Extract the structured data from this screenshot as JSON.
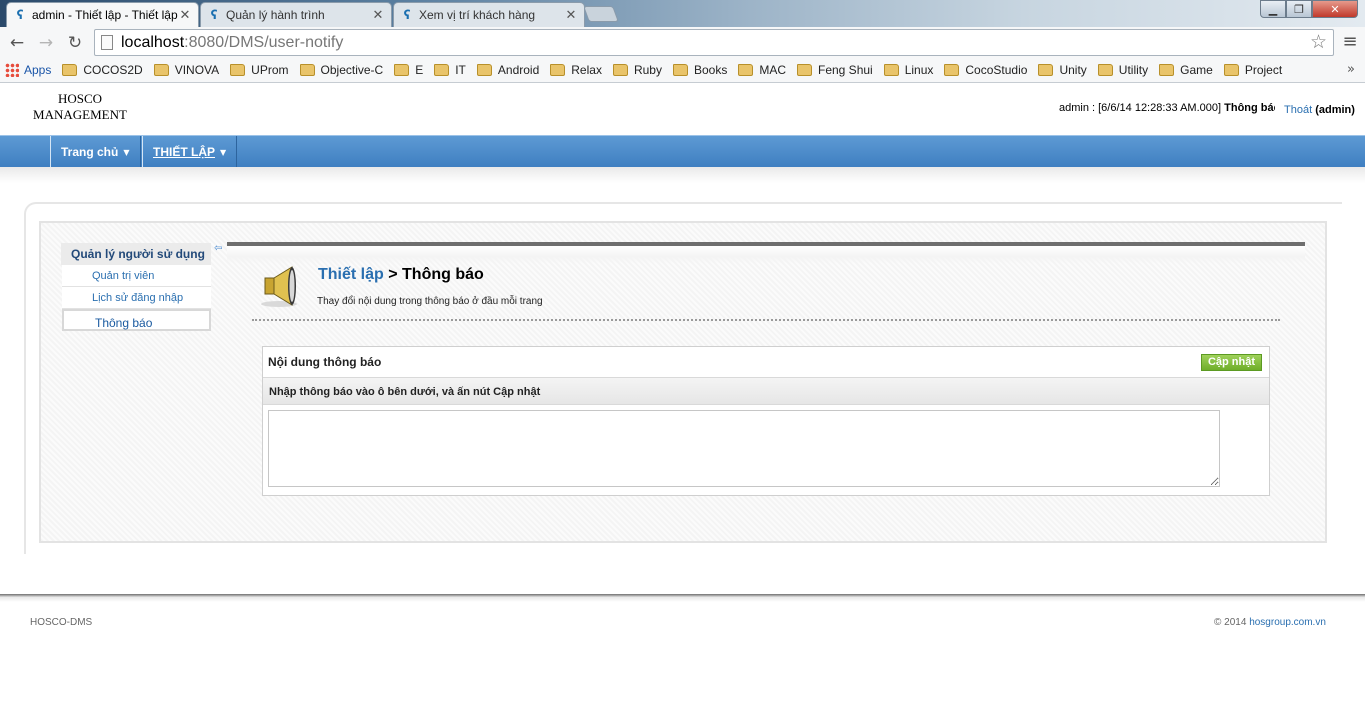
{
  "browser": {
    "tabs": [
      {
        "title": "admin - Thiết lập - Thiết lập",
        "active": true
      },
      {
        "title": "Quản lý hành trình",
        "active": false
      },
      {
        "title": "Xem vị trí khách hàng",
        "active": false
      }
    ],
    "url_host": "localhost",
    "url_rest": ":8080/DMS/user-notify",
    "bookmarks_apps": "Apps",
    "bookmarks": [
      "COCOS2D",
      "VINOVA",
      "UProm",
      "Objective-C",
      "E",
      "IT",
      "Android",
      "Relax",
      "Ruby",
      "Books",
      "MAC",
      "Feng Shui",
      "Linux",
      "CocoStudio",
      "Unity",
      "Utility",
      "Game",
      "Project"
    ],
    "more_glyph": "»"
  },
  "header": {
    "logo_line1": "HOSCO",
    "logo_line2": "MANAGEMENT",
    "user_status": "admin : [6/6/14 12:28:33 AM.000]",
    "user_status_bold": "Thông báo",
    "logout_label": "Thoát",
    "logout_user": "(admin)"
  },
  "nav": {
    "home": "Trang chủ",
    "settings": "THIẾT LẬP"
  },
  "sidebar": {
    "heading": "Quản lý người sử dụng",
    "items": [
      {
        "label": "Quản trị viên",
        "active": false
      },
      {
        "label": "Lịch sử đăng nhập",
        "active": false
      },
      {
        "label": "Thông báo",
        "active": true
      }
    ]
  },
  "main": {
    "breadcrumb_link": "Thiết lập",
    "separator": ">",
    "title": "Thông báo",
    "subtitle": "Thay đổi nội dung trong thông báo ở đầu mỗi trang",
    "panel_title": "Nội dung thông báo",
    "update_button": "Cập nhật",
    "instruction": "Nhập thông báo vào ô bên dưới, và ấn nút Cập nhật",
    "textarea_value": ""
  },
  "footer": {
    "left": "HOSCO-DMS",
    "copyright": "© 2014",
    "link": "hosgroup.com.vn"
  }
}
